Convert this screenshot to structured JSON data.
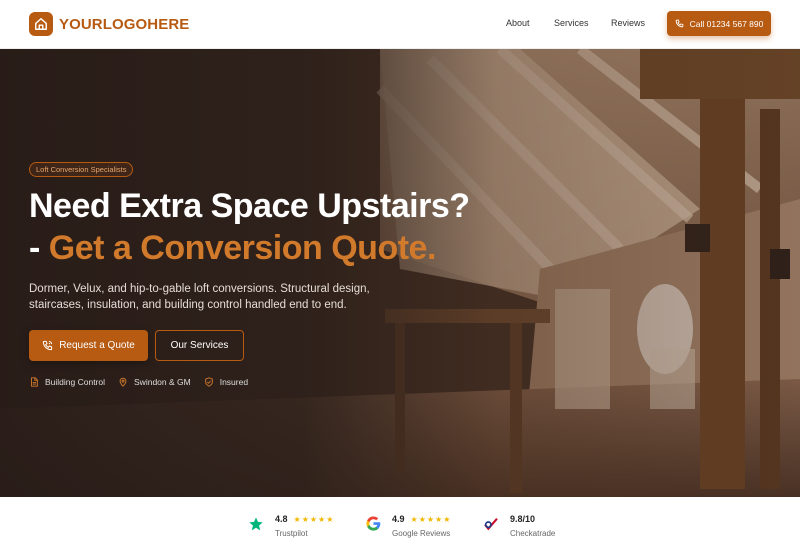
{
  "header": {
    "logo_text": "YOURLOGOHERE",
    "nav": [
      {
        "label": "About"
      },
      {
        "label": "Services"
      },
      {
        "label": "Reviews"
      }
    ],
    "call_label": "Call 01234 567 890"
  },
  "hero": {
    "badge": "Loft Conversion Specialists",
    "headline_line1": "Need Extra Space Upstairs?",
    "headline_line2_prefix": "- ",
    "headline_line2_accent": "Get a Conversion Quote.",
    "lead": "Dormer, Velux, and hip-to-gable loft conversions. Structural design, staircases, insulation, and building control handled end to end.",
    "primary_button": "Request a Quote",
    "secondary_button": "Our Services",
    "trust": [
      {
        "label": "Building Control",
        "icon": "document-icon"
      },
      {
        "label": "Swindon & GM",
        "icon": "map-pin-icon"
      },
      {
        "label": "Insured",
        "icon": "shield-check-icon"
      }
    ]
  },
  "reviews": [
    {
      "score": "4.8",
      "source": "Trustpilot",
      "stars": "★★★★★",
      "icon": "trustpilot-star-icon"
    },
    {
      "score": "4.9",
      "source": "Google Reviews",
      "stars": "★★★★★",
      "icon": "google-icon"
    },
    {
      "score": "9.8/10",
      "source": "Checkatrade",
      "icon": "checkatrade-icon"
    }
  ],
  "colors": {
    "brand": "#b75a12",
    "accent_text": "#d27a2c",
    "star": "#f2b705",
    "trustpilot": "#00b67a"
  }
}
